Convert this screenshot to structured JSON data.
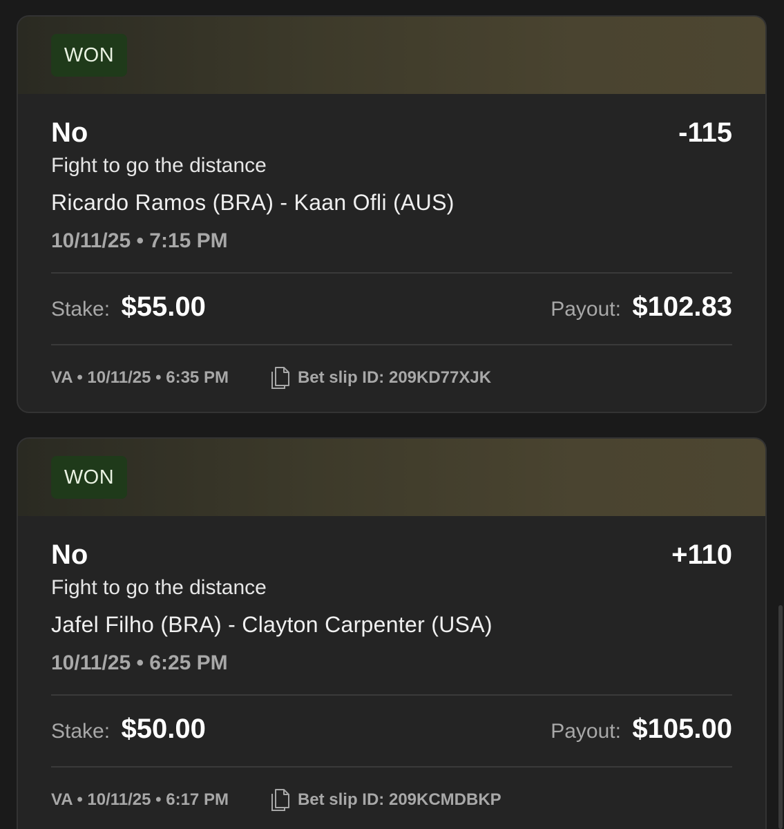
{
  "bets": [
    {
      "status": "WON",
      "selection": "No",
      "odds": "-115",
      "market": "Fight to go the distance",
      "event": "Ricardo Ramos (BRA) - Kaan Ofli (AUS)",
      "start_time": "10/11/25 • 7:15 PM",
      "stake_label": "Stake:",
      "stake_value": "$55.00",
      "payout_label": "Payout:",
      "payout_value": "$102.83",
      "placed": "VA • 10/11/25 • 6:35 PM",
      "slip_id": "Bet slip ID: 209KD77XJK"
    },
    {
      "status": "WON",
      "selection": "No",
      "odds": "+110",
      "market": "Fight to go the distance",
      "event": "Jafel Filho (BRA) - Clayton Carpenter (USA)",
      "start_time": "10/11/25 • 6:25 PM",
      "stake_label": "Stake:",
      "stake_value": "$50.00",
      "payout_label": "Payout:",
      "payout_value": "$105.00",
      "placed": "VA • 10/11/25 • 6:17 PM",
      "slip_id": "Bet slip ID: 209KCMDBKP"
    }
  ],
  "icons": {
    "slip": "document-copy-icon"
  },
  "colors": {
    "won_badge_bg": "#1f3a1a",
    "header_gradient_end": "#4d4631",
    "card_bg": "#242424",
    "page_bg": "#1a1a1a"
  }
}
